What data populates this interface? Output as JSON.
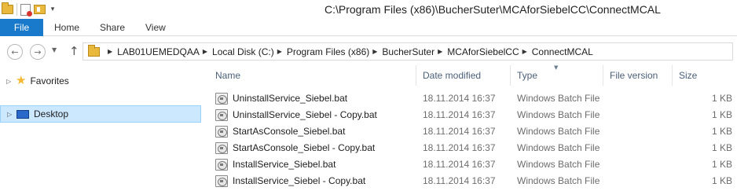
{
  "window": {
    "title": "C:\\Program Files (x86)\\BucherSuter\\MCAforSiebelCC\\ConnectMCAL"
  },
  "ribbon": {
    "tabs": [
      "File",
      "Home",
      "Share",
      "View"
    ]
  },
  "address": {
    "breadcrumbs": [
      "LAB01UEMEDQAA",
      "Local Disk (C:)",
      "Program Files (x86)",
      "BucherSuter",
      "MCAforSiebelCC",
      "ConnectMCAL"
    ]
  },
  "navpane": {
    "items": [
      {
        "label": "Favorites",
        "icon": "star-icon"
      },
      {
        "label": "Desktop",
        "icon": "desktop-icon"
      }
    ]
  },
  "filelist": {
    "columns": {
      "name": "Name",
      "date": "Date modified",
      "type": "Type",
      "version": "File version",
      "size": "Size"
    },
    "rows": [
      {
        "name": "UninstallService_Siebel.bat",
        "date": "18.11.2014 16:37",
        "type": "Windows Batch File",
        "size": "1 KB"
      },
      {
        "name": "UninstallService_Siebel - Copy.bat",
        "date": "18.11.2014 16:37",
        "type": "Windows Batch File",
        "size": "1 KB"
      },
      {
        "name": "StartAsConsole_Siebel.bat",
        "date": "18.11.2014 16:37",
        "type": "Windows Batch File",
        "size": "1 KB"
      },
      {
        "name": "StartAsConsole_Siebel - Copy.bat",
        "date": "18.11.2014 16:37",
        "type": "Windows Batch File",
        "size": "1 KB"
      },
      {
        "name": "InstallService_Siebel.bat",
        "date": "18.11.2014 16:37",
        "type": "Windows Batch File",
        "size": "1 KB"
      },
      {
        "name": "InstallService_Siebel - Copy.bat",
        "date": "18.11.2014 16:37",
        "type": "Windows Batch File",
        "size": "1 KB"
      }
    ]
  },
  "colors": {
    "file_tab": "#1979ca",
    "selection": "#cce8ff",
    "header_text": "#4c607a"
  }
}
